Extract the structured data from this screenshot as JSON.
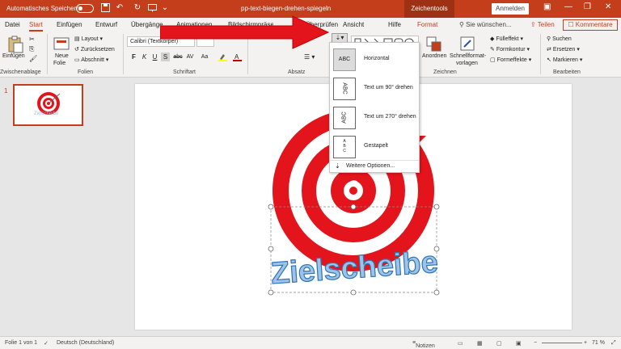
{
  "titlebar": {
    "autosave_label": "Automatisches Speichern",
    "autosave_state": "Aus",
    "doc_title": "pp-text-biegen-drehen-spiegeln",
    "context_tab": "Zeichentools",
    "signin_label": "Anmelden"
  },
  "tabs": [
    "Datei",
    "Start",
    "Einfügen",
    "Entwurf",
    "Übergänge",
    "Animationen",
    "Bildschirmpräsentation",
    "Überprüfen",
    "Ansicht",
    "Hilfe",
    "Format"
  ],
  "active_tab": "Start",
  "tell_me": "Sie wünschen...",
  "share_label": "Teilen",
  "comments_label": "Kommentare",
  "ribbon": {
    "clipboard": {
      "paste": "Einfügen",
      "label": "Zwischenablage"
    },
    "slides": {
      "new_slide": "Neue",
      "new_slide2": "Folie",
      "layout": "Layout",
      "reset": "Zurücksetzen",
      "section": "Abschnitt",
      "label": "Folien"
    },
    "font": {
      "font_name": "Calibri (Textkörper)",
      "font_size": "",
      "label": "Schriftart",
      "bold": "F",
      "italic": "K",
      "underline": "U",
      "shadow": "S",
      "strike": "abc",
      "spacing": "AV",
      "case": "Aa"
    },
    "paragraph": {
      "label": "Absatz"
    },
    "drawing": {
      "arrange": "Anordnen",
      "quick_styles": "Schnellformat-",
      "quick_styles2": "vorlagen",
      "fill": "Fülleffekt",
      "outline": "Formkontur",
      "effects": "Formeffekte",
      "label": "Zeichnen"
    },
    "editing": {
      "find": "Suchen",
      "replace": "Ersetzen",
      "select": "Markieren",
      "label": "Bearbeiten"
    }
  },
  "text_direction_menu": {
    "items": [
      {
        "label": "Horizontal",
        "icon_text": "ABC",
        "selected": true
      },
      {
        "label": "Text um 90° drehen",
        "icon_text": "ABC",
        "selected": false
      },
      {
        "label": "Text um 270° drehen",
        "icon_text": "ABC",
        "selected": false
      },
      {
        "label": "Gestapelt",
        "icon_text": "A B C",
        "selected": false
      }
    ],
    "more_options": "Weitere Optionen..."
  },
  "slide_panel": {
    "slide_number": "1",
    "thumb_caption": "Zielscheibe"
  },
  "slide": {
    "wordart_text": "Zielscheibe"
  },
  "statusbar": {
    "slide_info": "Folie 1 von 1",
    "language": "Deutsch (Deutschland)",
    "notes": "Notizen",
    "zoom": "71 %"
  },
  "colors": {
    "accent": "#c43e1c",
    "target_red": "#e3141b",
    "wordart_blue": "#5b9bd5"
  }
}
